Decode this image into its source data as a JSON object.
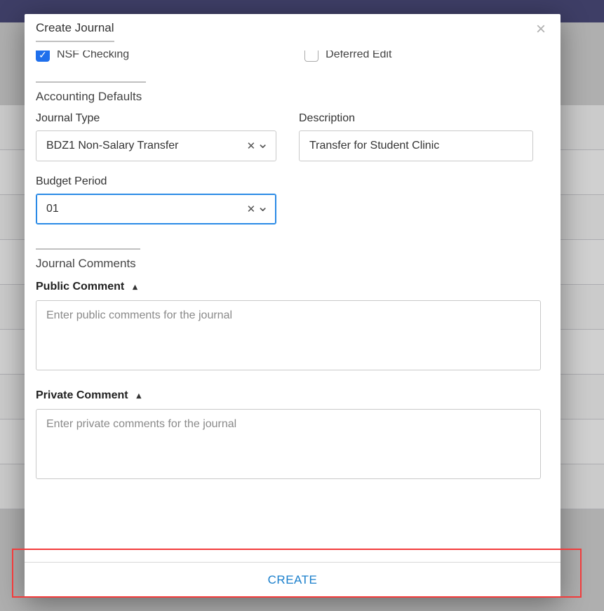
{
  "modal": {
    "title": "Create Journal",
    "checks": {
      "nsf_label": "NSF Checking",
      "nsf_checked": true,
      "deferred_label": "Deferred Edit",
      "deferred_checked": false
    },
    "accountingDefaults": {
      "heading": "Accounting Defaults",
      "journalType": {
        "label": "Journal Type",
        "value": "BDZ1 Non-Salary Transfer"
      },
      "description": {
        "label": "Description",
        "value": "Transfer for Student Clinic"
      },
      "budgetPeriod": {
        "label": "Budget Period",
        "value": "01"
      }
    },
    "journalComments": {
      "heading": "Journal Comments",
      "public": {
        "label": "Public Comment",
        "placeholder": "Enter public comments for the journal",
        "value": ""
      },
      "private": {
        "label": "Private Comment",
        "placeholder": "Enter private comments for the journal",
        "value": ""
      }
    },
    "footer": {
      "create_label": "CREATE"
    }
  },
  "icons": {
    "close": "×",
    "check": "✓",
    "clear": "✕",
    "chevronDown": "⌄",
    "caretUp": "▴"
  }
}
